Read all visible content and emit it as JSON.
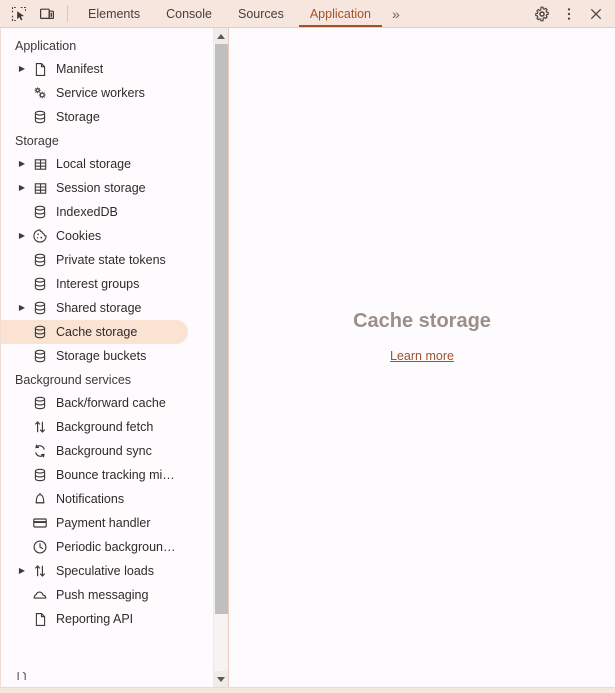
{
  "window": {
    "title": "DevTools",
    "accent_color": "#a0522d",
    "toolbar_bg": "#f7e6dd",
    "panel_bg": "#fdfbfd",
    "selection_bg": "#fbe3d3"
  },
  "toolbar": {
    "left_icons": [
      {
        "name": "inspect-element-icon",
        "tooltip": "Inspect element"
      },
      {
        "name": "device-toolbar-icon",
        "tooltip": "Toggle device toolbar"
      }
    ],
    "tabs": [
      {
        "label": "Elements",
        "active": false
      },
      {
        "label": "Console",
        "active": false
      },
      {
        "label": "Sources",
        "active": false
      },
      {
        "label": "Application",
        "active": true
      }
    ],
    "more_tabs_label": "»",
    "right_icons": [
      {
        "name": "gear-icon",
        "tooltip": "Settings"
      },
      {
        "name": "more-options-icon",
        "tooltip": "Customize and control DevTools"
      },
      {
        "name": "close-icon",
        "tooltip": "Close DevTools"
      }
    ]
  },
  "sidebar": {
    "sections": [
      {
        "title": "Application",
        "items": [
          {
            "label": "Manifest",
            "icon": "document-icon",
            "expandable": true,
            "selected": false
          },
          {
            "label": "Service workers",
            "icon": "gears-icon",
            "expandable": false,
            "selected": false
          },
          {
            "label": "Storage",
            "icon": "database-icon",
            "expandable": false,
            "selected": false
          }
        ]
      },
      {
        "title": "Storage",
        "items": [
          {
            "label": "Local storage",
            "icon": "table-icon",
            "expandable": true,
            "selected": false
          },
          {
            "label": "Session storage",
            "icon": "table-icon",
            "expandable": true,
            "selected": false
          },
          {
            "label": "IndexedDB",
            "icon": "database-icon",
            "expandable": false,
            "selected": false
          },
          {
            "label": "Cookies",
            "icon": "cookie-icon",
            "expandable": true,
            "selected": false
          },
          {
            "label": "Private state tokens",
            "icon": "database-icon",
            "expandable": false,
            "selected": false
          },
          {
            "label": "Interest groups",
            "icon": "database-icon",
            "expandable": false,
            "selected": false
          },
          {
            "label": "Shared storage",
            "icon": "database-icon",
            "expandable": true,
            "selected": false
          },
          {
            "label": "Cache storage",
            "icon": "database-icon",
            "expandable": false,
            "selected": true
          },
          {
            "label": "Storage buckets",
            "icon": "database-icon",
            "expandable": false,
            "selected": false
          }
        ]
      },
      {
        "title": "Background services",
        "items": [
          {
            "label": "Back/forward cache",
            "icon": "database-icon",
            "expandable": false,
            "selected": false
          },
          {
            "label": "Background fetch",
            "icon": "updown-arrows-icon",
            "expandable": false,
            "selected": false
          },
          {
            "label": "Background sync",
            "icon": "sync-icon",
            "expandable": false,
            "selected": false
          },
          {
            "label": "Bounce tracking mi…",
            "icon": "database-icon",
            "expandable": false,
            "selected": false
          },
          {
            "label": "Notifications",
            "icon": "bell-icon",
            "expandable": false,
            "selected": false
          },
          {
            "label": "Payment handler",
            "icon": "credit-card-icon",
            "expandable": false,
            "selected": false
          },
          {
            "label": "Periodic backgroun…",
            "icon": "clock-icon",
            "expandable": false,
            "selected": false
          },
          {
            "label": "Speculative loads",
            "icon": "updown-arrows-icon",
            "expandable": true,
            "selected": false
          },
          {
            "label": "Push messaging",
            "icon": "cloud-icon",
            "expandable": false,
            "selected": false
          },
          {
            "label": "Reporting API",
            "icon": "document-icon",
            "expandable": false,
            "selected": false
          }
        ]
      }
    ],
    "scrollbar": {
      "up_arrow": "scroll-up-arrow",
      "down_arrow": "scroll-down-arrow"
    }
  },
  "main": {
    "empty_state_title": "Cache storage",
    "empty_state_link": "Learn more"
  }
}
